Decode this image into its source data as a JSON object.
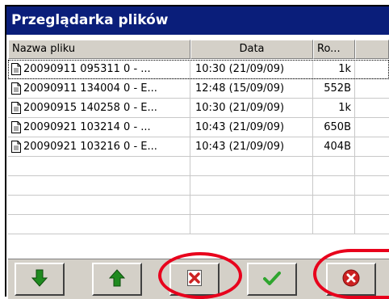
{
  "window": {
    "title": "Przeglądarka plików"
  },
  "table": {
    "headers": {
      "name": "Nazwa pliku",
      "date": "Data",
      "size": "Ro..."
    },
    "rows": [
      {
        "name": "20090911 095311 0 - ...",
        "date": "10:30 (21/09/09)",
        "size": "1k",
        "selected": true
      },
      {
        "name": "20090911 134004 0 - E...",
        "date": "12:48 (15/09/09)",
        "size": "552B"
      },
      {
        "name": "20090915 140258 0 - E...",
        "date": "10:30 (21/09/09)",
        "size": "1k"
      },
      {
        "name": "20090921 103214 0 - ...",
        "date": "10:43 (21/09/09)",
        "size": "650B"
      },
      {
        "name": "20090921 103216 0 - E...",
        "date": "10:43 (21/09/09)",
        "size": "404B"
      }
    ]
  },
  "toolbar": {
    "buttons": [
      {
        "icon": "arrow-down-icon",
        "color": "#1f8a1f"
      },
      {
        "icon": "arrow-up-icon",
        "color": "#1f8a1f"
      },
      {
        "icon": "delete-file-icon",
        "color": "#cc2222"
      },
      {
        "icon": "checkmark-icon",
        "color": "#2fa52f"
      },
      {
        "icon": "cancel-icon",
        "color": "#cc2222"
      }
    ]
  },
  "colors": {
    "titlebar": "#0a1e7a",
    "highlight_ring": "#e8001c"
  }
}
